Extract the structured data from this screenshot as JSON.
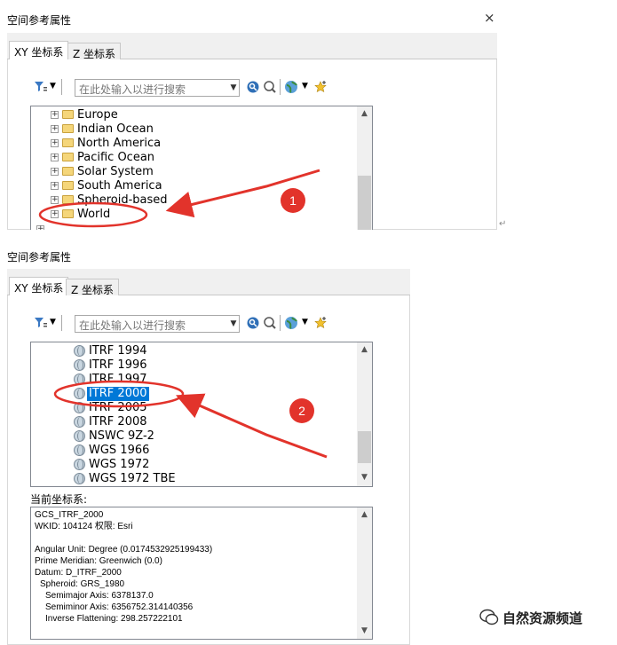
{
  "dialog1": {
    "title": "空间参考属性",
    "close": "×",
    "tabs": [
      "XY 坐标系",
      "Z 坐标系"
    ],
    "search_placeholder": "在此处输入以进行搜索",
    "tree_items": [
      "Europe",
      "Indian Ocean",
      "North America",
      "Pacific Ocean",
      "Solar System",
      "South America",
      "Spheroid-based",
      "World"
    ],
    "annotation_number": "1"
  },
  "dialog2": {
    "title": "空间参考属性",
    "tabs": [
      "XY 坐标系",
      "Z 坐标系"
    ],
    "search_placeholder": "在此处输入以进行搜索",
    "tree_items": [
      "ITRF 1994",
      "ITRF 1996",
      "ITRF 1997",
      "ITRF 2000",
      "ITRF 2005",
      "ITRF 2008",
      "NSWC 9Z-2",
      "WGS 1966",
      "WGS 1972",
      "WGS 1972 TBE"
    ],
    "selected_item": "ITRF 2000",
    "current_label": "当前坐标系:",
    "details": [
      "GCS_ITRF_2000",
      "WKID: 104124 权限: Esri",
      "",
      "Angular Unit: Degree (0.0174532925199433)",
      "Prime Meridian: Greenwich (0.0)",
      "Datum: D_ITRF_2000",
      "  Spheroid: GRS_1980",
      "    Semimajor Axis: 6378137.0",
      "    Semiminor Axis: 6356752.314140356",
      "    Inverse Flattening: 298.257222101"
    ],
    "annotation_number": "2"
  },
  "colors": {
    "highlight_circle": "#e2332b",
    "selection": "#0078d7",
    "arrow": "#e2332b"
  },
  "watermark": "自然资源频道"
}
